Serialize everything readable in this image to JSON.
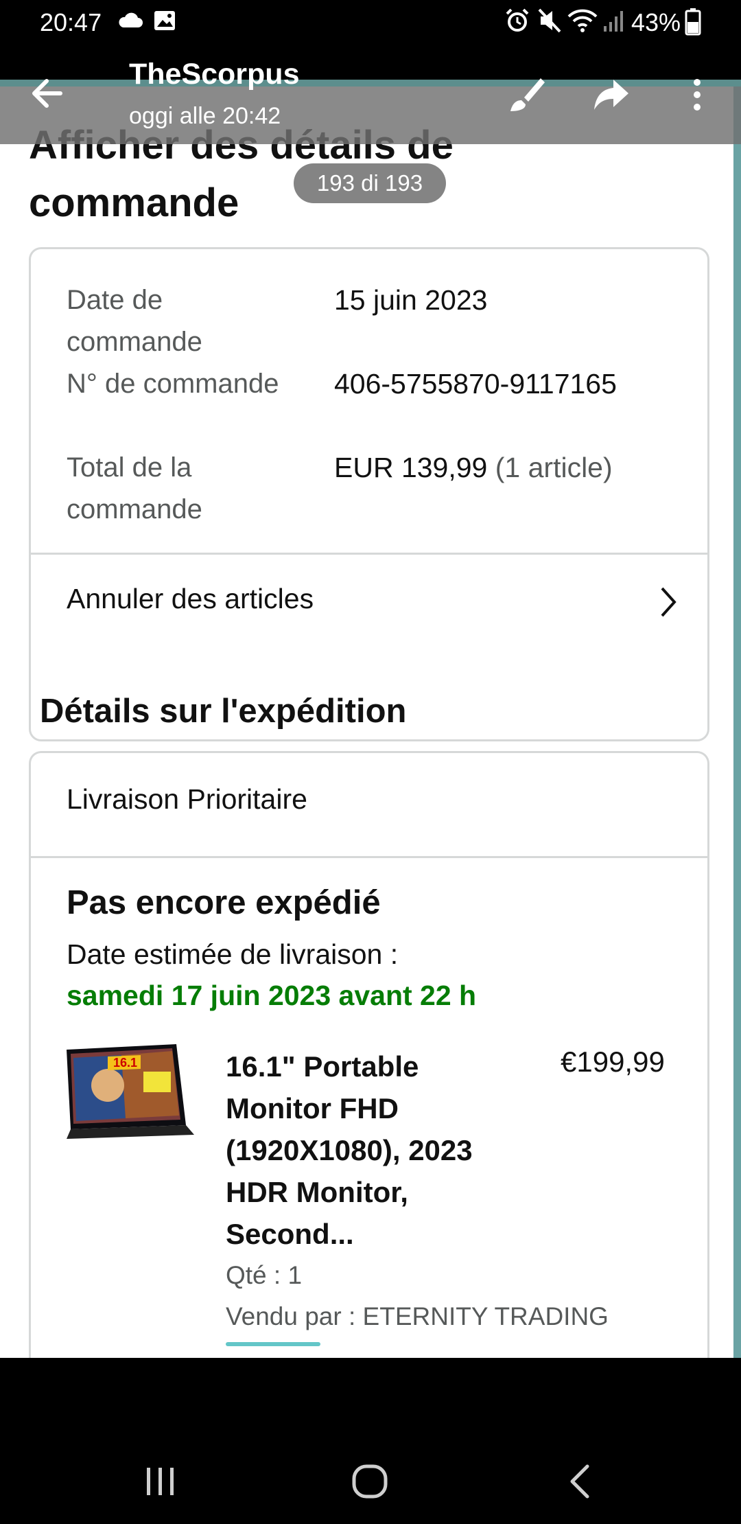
{
  "status_bar": {
    "time": "20:47",
    "battery_percent": "43%",
    "icons": [
      "cloud-icon",
      "gallery-icon",
      "alarm-icon",
      "mute-icon",
      "wifi-icon",
      "signal-icon",
      "battery-icon"
    ]
  },
  "viewer": {
    "sender": "TheScorpus",
    "timestamp": "oggi alle 20:42",
    "counter": "193 di 193",
    "actions": [
      "back-arrow-icon",
      "brush-icon",
      "share-icon",
      "more-vert-icon"
    ]
  },
  "page": {
    "title": "Afficher des détails de commande",
    "order": {
      "date_label": "Date de commande",
      "date_value": "15 juin 2023",
      "number_label": "N° de commande",
      "number_value": "406-5755870-9117165",
      "total_label": "Total de la commande",
      "total_value": "EUR 139,99",
      "total_items": "(1 article)",
      "cancel_label": "Annuler des articles"
    },
    "shipping": {
      "heading": "Détails sur l'expédition",
      "method": "Livraison Prioritaire",
      "status": "Pas encore expédié",
      "delivery_label": "Date estimée de livraison :",
      "delivery_date": "samedi 17 juin 2023 avant 22 h"
    },
    "product": {
      "title": "16.1\" Portable Monitor FHD (1920X1080), 2023 HDR Monitor, Second...",
      "price": "€199,99",
      "quantity": "Qté : 1",
      "seller": "Vendu par : ETERNITY TRADING",
      "image_badge": "16.1"
    }
  },
  "colors": {
    "delivery_green": "#067d06",
    "muted_text": "#565959",
    "border": "#d6d8d8"
  }
}
